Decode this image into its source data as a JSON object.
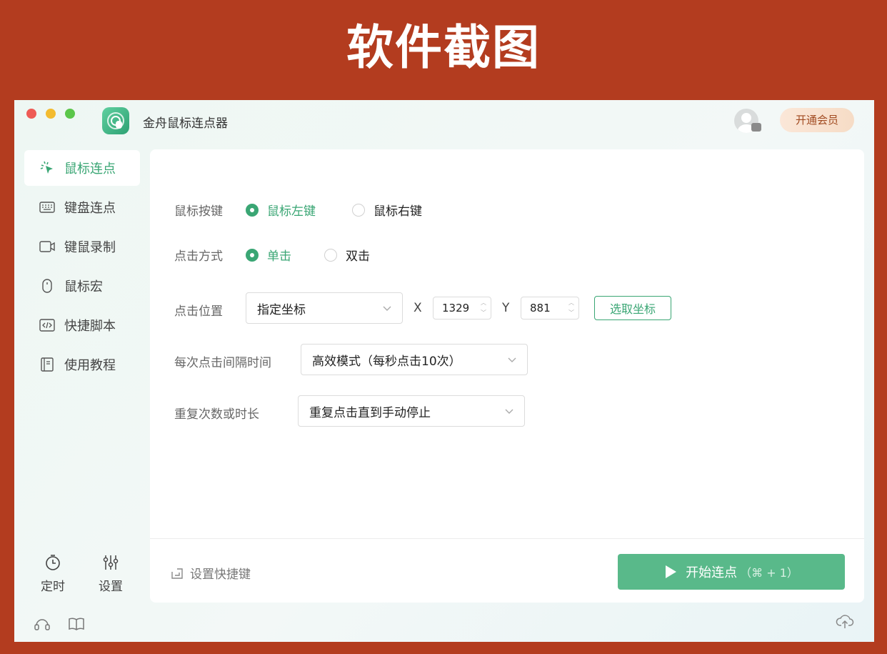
{
  "banner": {
    "title": "软件截图"
  },
  "window": {
    "app_title": "金舟鼠标连点器",
    "vip_label": "开通会员",
    "accent_color": "#3aa674",
    "icons": [
      "app-logo-icon",
      "avatar-icon"
    ]
  },
  "sidebar": {
    "items": [
      {
        "label": "鼠标连点",
        "icon": "mouse-click-icon",
        "active": true
      },
      {
        "label": "键盘连点",
        "icon": "keyboard-icon",
        "active": false
      },
      {
        "label": "键鼠录制",
        "icon": "video-record-icon",
        "active": false
      },
      {
        "label": "鼠标宏",
        "icon": "mouse-icon",
        "active": false
      },
      {
        "label": "快捷脚本",
        "icon": "code-icon",
        "active": false
      },
      {
        "label": "使用教程",
        "icon": "book-icon",
        "active": false
      }
    ],
    "bottom_tools": [
      {
        "label": "定时",
        "icon": "timer-icon"
      },
      {
        "label": "设置",
        "icon": "sliders-icon"
      }
    ],
    "footer_icons": [
      "headset-icon",
      "open-book-icon"
    ]
  },
  "form": {
    "mouse_button": {
      "label": "鼠标按键",
      "options": [
        "鼠标左键",
        "鼠标右键"
      ],
      "selected": "鼠标左键"
    },
    "click_type": {
      "label": "点击方式",
      "options": [
        "单击",
        "双击"
      ],
      "selected": "单击"
    },
    "position": {
      "label": "点击位置",
      "mode": "指定坐标",
      "x_label": "X",
      "x_value": "1329",
      "y_label": "Y",
      "y_value": "881",
      "pick_label": "选取坐标"
    },
    "interval": {
      "label": "每次点击间隔时间",
      "value": "高效模式（每秒点击10次）"
    },
    "repeat": {
      "label": "重复次数或时长",
      "value": "重复点击直到手动停止"
    }
  },
  "footer": {
    "hotkey_label": "设置快捷键",
    "start_label": "开始连点",
    "start_hint": "（⌘ + 1）",
    "upload_icon": "cloud-upload-icon"
  }
}
